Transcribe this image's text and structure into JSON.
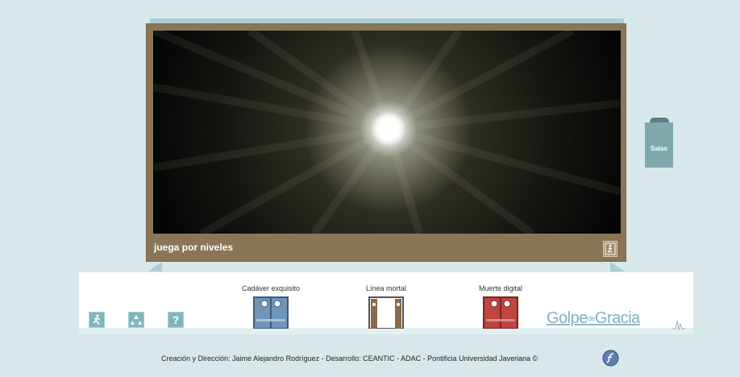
{
  "frame": {
    "label": "juega por niveles"
  },
  "sidebar": {
    "salas_label": "Salas"
  },
  "toolbar": {
    "exit_icon": "exit-runner-icon",
    "buttons": [
      {
        "name": "exit-button",
        "icon": "running-man-icon"
      },
      {
        "name": "recycle-button",
        "icon": "recycle-icon"
      },
      {
        "name": "help-button",
        "glyph": "?"
      }
    ]
  },
  "rooms": [
    {
      "label": "Cadáver exquisito",
      "color": "#6f95b8",
      "state": "closed"
    },
    {
      "label": "Línea mortal",
      "color": "#8a6a4a",
      "state": "open"
    },
    {
      "label": "Muerte digital",
      "color": "#c0443f",
      "state": "closed"
    }
  ],
  "logo": {
    "part1": "Golpe",
    "part2": "de",
    "part3": "Gracia"
  },
  "footer": {
    "credits": "Creación y Dirección: Jaime Alejandro Rodríguez - Desarrollo: CEANTIC - ADAC - Pontificia Universidad Javeriana ©"
  },
  "colors": {
    "background": "#d8e8ea",
    "frame": "#8a7558",
    "teal": "#7fb7b9"
  }
}
